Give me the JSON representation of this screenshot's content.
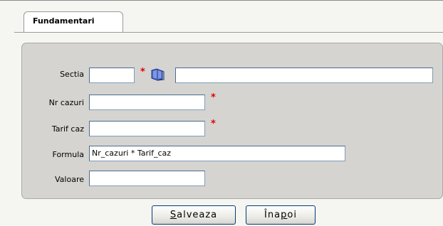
{
  "tab": {
    "label": "Fundamentari"
  },
  "form": {
    "sectia": {
      "label": "Sectia",
      "code": "",
      "name": ""
    },
    "nr_cazuri": {
      "label": "Nr cazuri",
      "value": ""
    },
    "tarif_caz": {
      "label": "Tarif caz",
      "value": ""
    },
    "formula": {
      "label": "Formula",
      "value": "Nr_cazuri * Tarif_caz"
    },
    "valoare": {
      "label": "Valoare",
      "value": ""
    },
    "required_mark": "*"
  },
  "buttons": {
    "save": {
      "label": "Salveaza",
      "mnemonic": "S",
      "rest": "alveaza"
    },
    "back": {
      "label": "Înapoi",
      "pre": "Îna",
      "mnemonic": "p",
      "post": "oi"
    }
  },
  "colors": {
    "panel": "#d5d4d0",
    "required": "#e00000",
    "input_border": "#7f9db9"
  }
}
